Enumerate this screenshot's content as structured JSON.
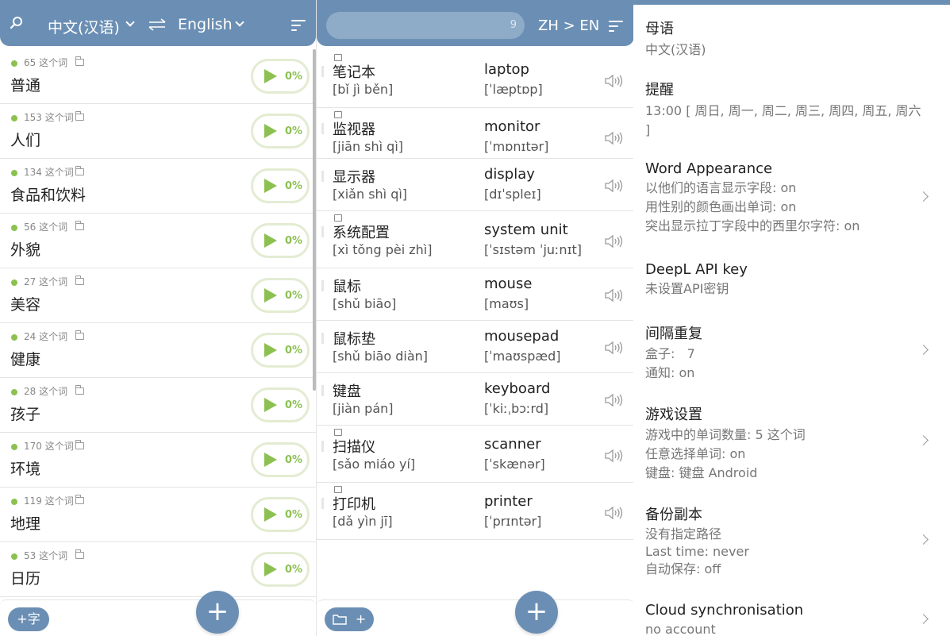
{
  "colors": {
    "primary": "#6b8fb4",
    "accent_green": "#8cc152",
    "pill_border": "#e3ecd2"
  },
  "icons": [
    "search-icon",
    "swap-icon",
    "sort-icon",
    "folder-icon",
    "play-icon",
    "image-icon",
    "speaker-icon",
    "plus-icon",
    "chevron-right-icon"
  ],
  "categories_panel": {
    "source_language": "中文(汉语)",
    "target_language": "English",
    "categories": [
      {
        "count_label": "65 这个词",
        "name": "普通",
        "progress": "0%"
      },
      {
        "count_label": "153 这个词",
        "name": "人们",
        "progress": "0%"
      },
      {
        "count_label": "134 这个词",
        "name": "食品和饮料",
        "progress": "0%"
      },
      {
        "count_label": "56 这个词",
        "name": "外貌",
        "progress": "0%"
      },
      {
        "count_label": "27 这个词",
        "name": "美容",
        "progress": "0%"
      },
      {
        "count_label": "24 这个词",
        "name": "健康",
        "progress": "0%"
      },
      {
        "count_label": "28 这个词",
        "name": "孩子",
        "progress": "0%"
      },
      {
        "count_label": "170 这个词",
        "name": "环境",
        "progress": "0%"
      },
      {
        "count_label": "119 这个词",
        "name": "地理",
        "progress": "0%"
      },
      {
        "count_label": "53 这个词",
        "name": "日历",
        "progress": "0%"
      }
    ],
    "add_word_label": "+字",
    "fab_label": "+"
  },
  "words_panel": {
    "search_count": "9",
    "direction_label": "ZH > EN",
    "words": [
      {
        "hanzi": "笔记本",
        "pinyin": "[bǐ jì běn]",
        "english": "laptop",
        "ipa": "[ˈlæptɒp]",
        "has_image": true
      },
      {
        "hanzi": "监视器",
        "pinyin": "[jiān shì qì]",
        "english": "monitor",
        "ipa": "[ˈmɒnɪtər]",
        "has_image": true
      },
      {
        "hanzi": "显示器",
        "pinyin": "[xiǎn shì qì]",
        "english": "display",
        "ipa": "[dɪˈspleɪ]",
        "has_image": false
      },
      {
        "hanzi": "系统配置",
        "pinyin": "[xì tǒng pèi zhì]",
        "english": "system unit",
        "ipa": "[ˈsɪstəm ˈjuːnɪt]",
        "has_image": true
      },
      {
        "hanzi": "鼠标",
        "pinyin": "[shǔ biāo]",
        "english": "mouse",
        "ipa": "[maʊs]",
        "has_image": false
      },
      {
        "hanzi": "鼠标垫",
        "pinyin": "[shǔ biāo diàn]",
        "english": "mousepad",
        "ipa": "[ˈmaʊspæd]",
        "has_image": false
      },
      {
        "hanzi": "键盘",
        "pinyin": "[jiàn pán]",
        "english": "keyboard",
        "ipa": "[ˈkiːˌbɔːrd]",
        "has_image": false
      },
      {
        "hanzi": "扫描仪",
        "pinyin": "[sǎo miáo yí]",
        "english": "scanner",
        "ipa": "[ˈskænər]",
        "has_image": true
      },
      {
        "hanzi": "打印机",
        "pinyin": "[dǎ yìn jī]",
        "english": "printer",
        "ipa": "[ˈprɪntər]",
        "has_image": true
      }
    ],
    "fab_label": "+",
    "folder_add_label": "+"
  },
  "settings_panel": {
    "native_language": {
      "title": "母语",
      "value": "中文(汉语)"
    },
    "reminder": {
      "title": "提醒",
      "value": "13:00 [ 周日, 周一, 周二, 周三, 周四, 周五, 周六 ]"
    },
    "word_appearance": {
      "title": "Word Appearance",
      "lines": [
        "以他们的语言显示字段: on",
        "用性别的颜色画出单词: on",
        "突出显示拉丁字段中的西里尔字符: on"
      ]
    },
    "deepl": {
      "title": "DeepL API key",
      "value": "未设置API密钥"
    },
    "spaced_repetition": {
      "title": "间隔重复",
      "lines": [
        "盒子:   7",
        "通知: on"
      ]
    },
    "game_settings": {
      "title": "游戏设置",
      "lines": [
        "游戏中的单词数量: 5 这个词",
        "任意选择单词: on",
        "键盘: 键盘 Android"
      ]
    },
    "backup": {
      "title": "备份副本",
      "lines": [
        "没有指定路径",
        "Last time: never",
        "自动保存: off"
      ]
    },
    "cloud_sync": {
      "title": "Cloud synchronisation",
      "value": "no account"
    }
  }
}
